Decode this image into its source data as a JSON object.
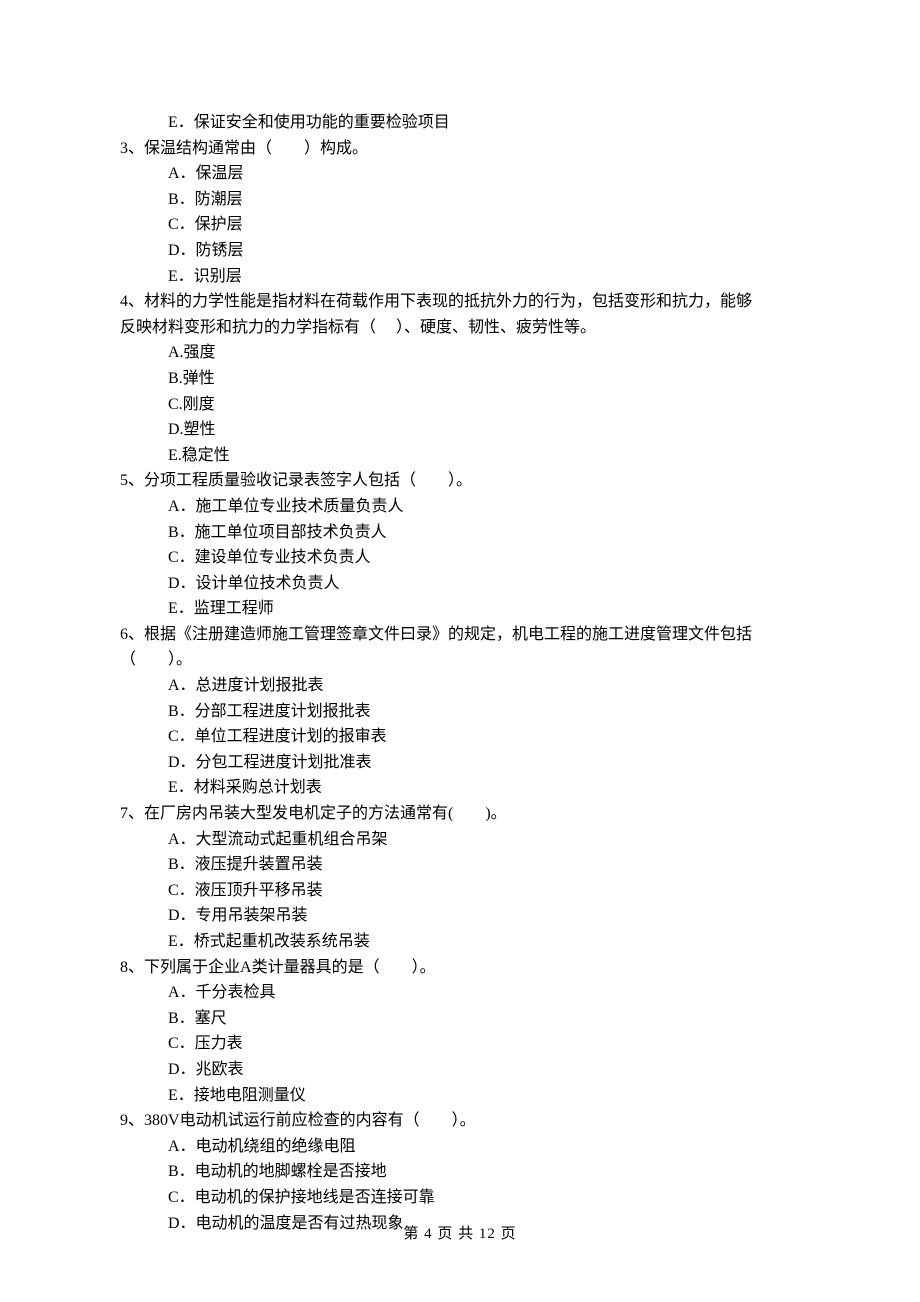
{
  "trailing_option": "E．保证安全和使用功能的重要检验项目",
  "questions": [
    {
      "num": "3、",
      "stem": "保温结构通常由（　　）构成。",
      "options": [
        "A．保温层",
        "B．防潮层",
        "C．保护层",
        "D．防锈层",
        "E．识别层"
      ]
    },
    {
      "num": "4、",
      "stem": "材料的力学性能是指材料在荷载作用下表现的抵抗外力的行为，包括变形和抗力，能够",
      "stem_cont": "反映材料变形和抗力的力学指标有（　 ）、硬度、韧性、疲劳性等。",
      "options": [
        "A.强度",
        "B.弹性",
        "C.刚度",
        "D.塑性",
        "E.稳定性"
      ]
    },
    {
      "num": "5、",
      "stem": "分项工程质量验收记录表签字人包括（　　）。",
      "options": [
        "A．施工单位专业技术质量负责人",
        "B．施工单位项目部技术负责人",
        "C．建设单位专业技术负责人",
        "D．设计单位技术负责人",
        "E．监理工程师"
      ]
    },
    {
      "num": "6、",
      "stem": "根据《注册建造师施工管理签章文件曰录》的规定，机电工程的施工进度管理文件包括",
      "stem_cont": "（　　）。",
      "options": [
        "A．总进度计划报批表",
        "B．分部工程进度计划报批表",
        "C．单位工程进度计划的报审表",
        "D．分包工程进度计划批准表",
        "E．材料采购总计划表"
      ]
    },
    {
      "num": "7、",
      "stem": "在厂房内吊装大型发电机定子的方法通常有(　　)。",
      "options": [
        "A．大型流动式起重机组合吊架",
        "B．液压提升装置吊装",
        "C．液压顶升平移吊装",
        "D．专用吊装架吊装",
        "E．桥式起重机改装系统吊装"
      ]
    },
    {
      "num": "8、",
      "stem": "下列属于企业A类计量器具的是（　　）。",
      "options": [
        "A．千分表检具",
        "B．塞尺",
        "C．压力表",
        "D．兆欧表",
        "E．接地电阻测量仪"
      ]
    },
    {
      "num": "9、",
      "stem": "380V电动机试运行前应检查的内容有（　　）。",
      "options": [
        "A．电动机绕组的绝缘电阻",
        "B．电动机的地脚螺栓是否接地",
        "C．电动机的保护接地线是否连接可靠",
        "D．电动机的温度是否有过热现象"
      ]
    }
  ],
  "footer": "第 4 页 共 12 页"
}
